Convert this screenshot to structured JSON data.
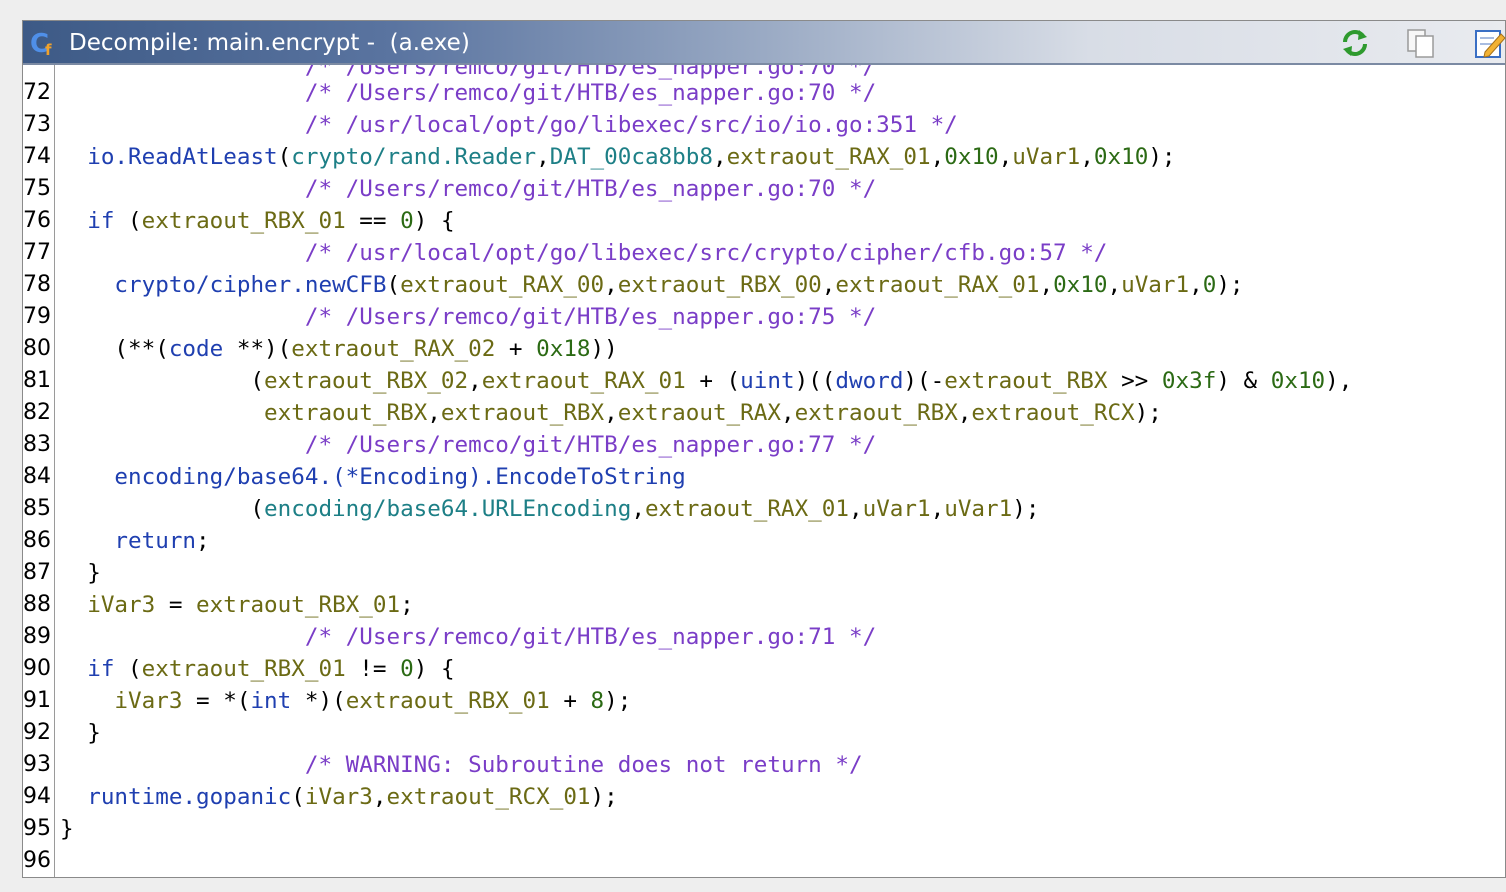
{
  "window": {
    "title": "Decompile: main.encrypt -  (a.exe)",
    "title_icon": "decompiler-c-icon",
    "buttons": [
      {
        "name": "refresh-button",
        "icon": "refresh-icon"
      },
      {
        "name": "copy-button",
        "icon": "copy-icon"
      },
      {
        "name": "edit-button",
        "icon": "edit-icon"
      }
    ]
  },
  "colors": {
    "comment": "#7a3dc7",
    "function": "#1f3fb0",
    "variable": "#6b6a14",
    "number": "#2b6a14",
    "global": "#1d7f86"
  },
  "code_lines": [
    {
      "n": "72",
      "tokens": [
        {
          "t": "                  "
        },
        {
          "c": "cm",
          "t": "/* /Users/remco/git/HTB/es_napper.go:70 */"
        }
      ]
    },
    {
      "n": "73",
      "tokens": [
        {
          "t": "                  "
        },
        {
          "c": "cm",
          "t": "/* /usr/local/opt/go/libexec/src/io/io.go:351 */"
        }
      ]
    },
    {
      "n": "74",
      "tokens": [
        {
          "t": "  "
        },
        {
          "c": "fn",
          "t": "io.ReadAtLeast"
        },
        {
          "t": "("
        },
        {
          "c": "g",
          "t": "crypto/rand.Reader"
        },
        {
          "t": ","
        },
        {
          "c": "g",
          "t": "DAT_00ca8bb8"
        },
        {
          "t": ","
        },
        {
          "c": "v",
          "t": "extraout_RAX_01"
        },
        {
          "t": ","
        },
        {
          "c": "n",
          "t": "0x10"
        },
        {
          "t": ","
        },
        {
          "c": "v",
          "t": "uVar1"
        },
        {
          "t": ","
        },
        {
          "c": "n",
          "t": "0x10"
        },
        {
          "t": ");"
        }
      ]
    },
    {
      "n": "75",
      "tokens": [
        {
          "t": "                  "
        },
        {
          "c": "cm",
          "t": "/* /Users/remco/git/HTB/es_napper.go:70 */"
        }
      ]
    },
    {
      "n": "76",
      "tokens": [
        {
          "t": "  "
        },
        {
          "c": "k",
          "t": "if"
        },
        {
          "t": " ("
        },
        {
          "c": "v",
          "t": "extraout_RBX_01"
        },
        {
          "t": " == "
        },
        {
          "c": "n",
          "t": "0"
        },
        {
          "t": ") {"
        }
      ]
    },
    {
      "n": "77",
      "tokens": [
        {
          "t": "                  "
        },
        {
          "c": "cm",
          "t": "/* /usr/local/opt/go/libexec/src/crypto/cipher/cfb.go:57 */"
        }
      ]
    },
    {
      "n": "78",
      "tokens": [
        {
          "t": "    "
        },
        {
          "c": "fn",
          "t": "crypto/cipher.newCFB"
        },
        {
          "t": "("
        },
        {
          "c": "v",
          "t": "extraout_RAX_00"
        },
        {
          "t": ","
        },
        {
          "c": "v",
          "t": "extraout_RBX_00"
        },
        {
          "t": ","
        },
        {
          "c": "v",
          "t": "extraout_RAX_01"
        },
        {
          "t": ","
        },
        {
          "c": "n",
          "t": "0x10"
        },
        {
          "t": ","
        },
        {
          "c": "v",
          "t": "uVar1"
        },
        {
          "t": ","
        },
        {
          "c": "n",
          "t": "0"
        },
        {
          "t": ");"
        }
      ]
    },
    {
      "n": "79",
      "tokens": [
        {
          "t": "                  "
        },
        {
          "c": "cm",
          "t": "/* /Users/remco/git/HTB/es_napper.go:75 */"
        }
      ]
    },
    {
      "n": "80",
      "tokens": [
        {
          "t": "    (**("
        },
        {
          "c": "k",
          "t": "code"
        },
        {
          "t": " **)("
        },
        {
          "c": "v",
          "t": "extraout_RAX_02"
        },
        {
          "t": " + "
        },
        {
          "c": "n",
          "t": "0x18"
        },
        {
          "t": "))"
        }
      ]
    },
    {
      "n": "81",
      "tokens": [
        {
          "t": "              ("
        },
        {
          "c": "v",
          "t": "extraout_RBX_02"
        },
        {
          "t": ","
        },
        {
          "c": "v",
          "t": "extraout_RAX_01"
        },
        {
          "t": " + ("
        },
        {
          "c": "k",
          "t": "uint"
        },
        {
          "t": ")(("
        },
        {
          "c": "k",
          "t": "dword"
        },
        {
          "t": ")(-"
        },
        {
          "c": "v",
          "t": "extraout_RBX"
        },
        {
          "t": " >> "
        },
        {
          "c": "n",
          "t": "0x3f"
        },
        {
          "t": ") & "
        },
        {
          "c": "n",
          "t": "0x10"
        },
        {
          "t": "),"
        }
      ]
    },
    {
      "n": "82",
      "tokens": [
        {
          "t": "               "
        },
        {
          "c": "v",
          "t": "extraout_RBX"
        },
        {
          "t": ","
        },
        {
          "c": "v",
          "t": "extraout_RBX"
        },
        {
          "t": ","
        },
        {
          "c": "v",
          "t": "extraout_RAX"
        },
        {
          "t": ","
        },
        {
          "c": "v",
          "t": "extraout_RBX"
        },
        {
          "t": ","
        },
        {
          "c": "v",
          "t": "extraout_RCX"
        },
        {
          "t": ");"
        }
      ]
    },
    {
      "n": "83",
      "tokens": [
        {
          "t": "                  "
        },
        {
          "c": "cm",
          "t": "/* /Users/remco/git/HTB/es_napper.go:77 */"
        }
      ]
    },
    {
      "n": "84",
      "tokens": [
        {
          "t": "    "
        },
        {
          "c": "fn",
          "t": "encoding/base64.(*Encoding).EncodeToString"
        }
      ]
    },
    {
      "n": "85",
      "tokens": [
        {
          "t": "              ("
        },
        {
          "c": "g",
          "t": "encoding/base64.URLEncoding"
        },
        {
          "t": ","
        },
        {
          "c": "v",
          "t": "extraout_RAX_01"
        },
        {
          "t": ","
        },
        {
          "c": "v",
          "t": "uVar1"
        },
        {
          "t": ","
        },
        {
          "c": "v",
          "t": "uVar1"
        },
        {
          "t": ");"
        }
      ]
    },
    {
      "n": "86",
      "tokens": [
        {
          "t": "    "
        },
        {
          "c": "k",
          "t": "return"
        },
        {
          "t": ";"
        }
      ]
    },
    {
      "n": "87",
      "tokens": [
        {
          "t": "  }"
        }
      ]
    },
    {
      "n": "88",
      "tokens": [
        {
          "t": "  "
        },
        {
          "c": "v",
          "t": "iVar3"
        },
        {
          "t": " = "
        },
        {
          "c": "v",
          "t": "extraout_RBX_01"
        },
        {
          "t": ";"
        }
      ]
    },
    {
      "n": "89",
      "tokens": [
        {
          "t": "                  "
        },
        {
          "c": "cm",
          "t": "/* /Users/remco/git/HTB/es_napper.go:71 */"
        }
      ]
    },
    {
      "n": "90",
      "tokens": [
        {
          "t": "  "
        },
        {
          "c": "k",
          "t": "if"
        },
        {
          "t": " ("
        },
        {
          "c": "v",
          "t": "extraout_RBX_01"
        },
        {
          "t": " != "
        },
        {
          "c": "n",
          "t": "0"
        },
        {
          "t": ") {"
        }
      ]
    },
    {
      "n": "91",
      "tokens": [
        {
          "t": "    "
        },
        {
          "c": "v",
          "t": "iVar3"
        },
        {
          "t": " = *("
        },
        {
          "c": "k",
          "t": "int"
        },
        {
          "t": " *)("
        },
        {
          "c": "v",
          "t": "extraout_RBX_01"
        },
        {
          "t": " + "
        },
        {
          "c": "n",
          "t": "8"
        },
        {
          "t": ");"
        }
      ]
    },
    {
      "n": "92",
      "tokens": [
        {
          "t": "  }"
        }
      ]
    },
    {
      "n": "93",
      "tokens": [
        {
          "t": "                  "
        },
        {
          "c": "cm",
          "t": "/* WARNING: Subroutine does not return */"
        }
      ]
    },
    {
      "n": "94",
      "tokens": [
        {
          "t": "  "
        },
        {
          "c": "fn",
          "t": "runtime.gopanic"
        },
        {
          "t": "("
        },
        {
          "c": "v",
          "t": "iVar3"
        },
        {
          "t": ","
        },
        {
          "c": "v",
          "t": "extraout_RCX_01"
        },
        {
          "t": ");"
        }
      ]
    },
    {
      "n": "95",
      "tokens": [
        {
          "t": "}"
        }
      ]
    },
    {
      "n": "96",
      "tokens": []
    }
  ]
}
